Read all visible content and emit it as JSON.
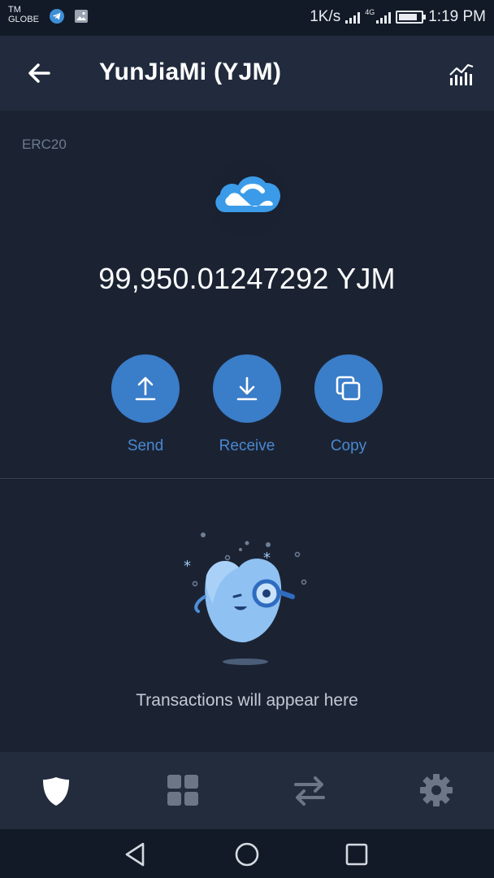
{
  "status_bar": {
    "carrier_line1": "TM",
    "carrier_line2": "GLOBE",
    "net_speed": "1K/s",
    "network_type": "4G",
    "time": "1:19 PM",
    "battery_level": 0.85
  },
  "app_bar": {
    "title": "YunJiaMi (YJM)",
    "back_icon": "arrow-left-icon",
    "chart_icon": "market-chart-icon"
  },
  "token": {
    "network": "ERC20",
    "balance": "99,950.01247292 YJM",
    "logo_icon": "cloud-logo-icon"
  },
  "actions": [
    {
      "label": "Send",
      "icon": "upload-arrow-icon"
    },
    {
      "label": "Receive",
      "icon": "download-arrow-icon"
    },
    {
      "label": "Copy",
      "icon": "copy-icon"
    }
  ],
  "empty_state": {
    "message": "Transactions will appear here",
    "illustration": "magnifier-mascot-icon"
  },
  "tabs": [
    {
      "name": "wallet",
      "icon": "shield-icon",
      "active": true
    },
    {
      "name": "dapps",
      "icon": "grid-icon",
      "active": false
    },
    {
      "name": "swap",
      "icon": "swap-arrows-icon",
      "active": false
    },
    {
      "name": "settings",
      "icon": "gear-icon",
      "active": false
    }
  ],
  "colors": {
    "background": "#1b2333",
    "app_bar": "#212b3d",
    "accent": "#3a7dc9",
    "accent_text": "#4a88d0",
    "muted_text": "#6e7a8e",
    "inactive_tab": "#6c7686"
  }
}
